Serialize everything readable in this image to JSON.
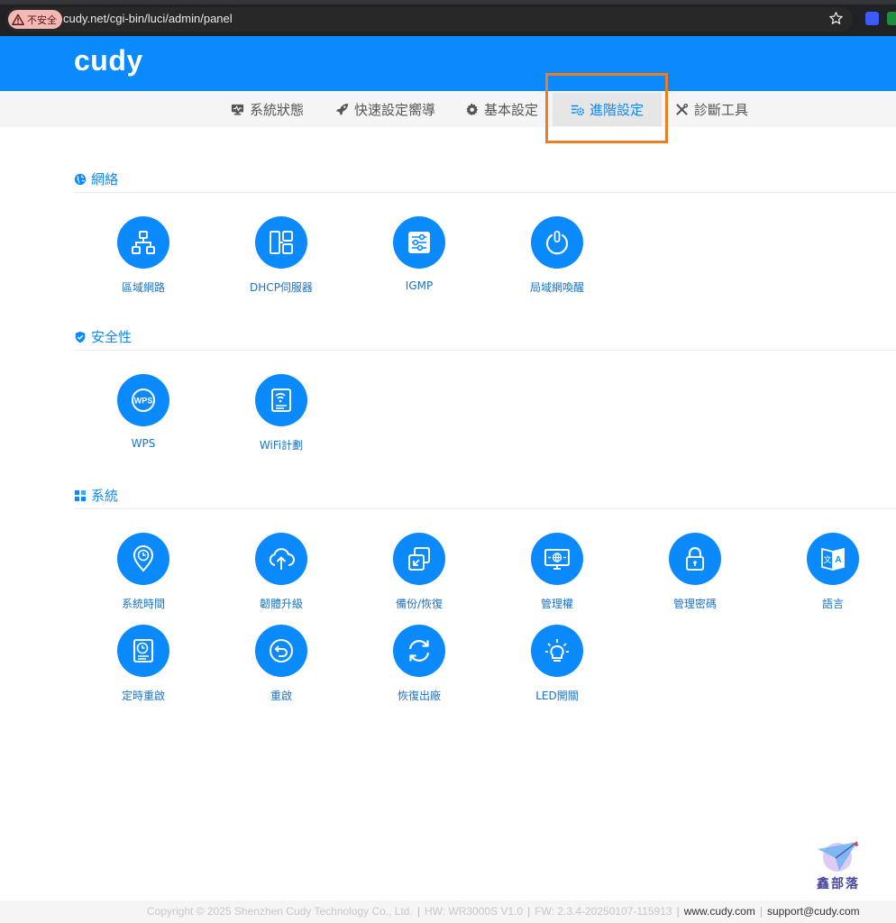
{
  "browser": {
    "security_label": "不安全",
    "url": "cudy.net/cgi-bin/luci/admin/panel"
  },
  "header": {
    "logo": "cudy"
  },
  "nav": {
    "items": [
      {
        "label": "系統狀態",
        "icon": "monitor-icon"
      },
      {
        "label": "快速設定嚮導",
        "icon": "rocket-icon"
      },
      {
        "label": "基本設定",
        "icon": "gear-icon"
      },
      {
        "label": "進階設定",
        "icon": "sliders-gear-icon",
        "active": true
      },
      {
        "label": "診斷工具",
        "icon": "tools-icon"
      }
    ]
  },
  "sections": [
    {
      "title": "網絡",
      "icon": "globe-icon",
      "items": [
        {
          "label": "區域網路",
          "icon": "lan-icon"
        },
        {
          "label": "DHCP伺服器",
          "icon": "server-icon"
        },
        {
          "label": "IGMP",
          "icon": "igmp-icon"
        },
        {
          "label": "局域網喚醒",
          "icon": "power-icon"
        }
      ]
    },
    {
      "title": "安全性",
      "icon": "shield-icon",
      "items": [
        {
          "label": "WPS",
          "icon": "wps-icon"
        },
        {
          "label": "WiFi計劃",
          "icon": "wifi-schedule-icon"
        }
      ]
    },
    {
      "title": "系統",
      "icon": "grid-icon",
      "items": [
        {
          "label": "系統時間",
          "icon": "clock-pin-icon"
        },
        {
          "label": "韌體升級",
          "icon": "cloud-upload-icon"
        },
        {
          "label": "備份/恢復",
          "icon": "backup-icon"
        },
        {
          "label": "管理權",
          "icon": "management-icon"
        },
        {
          "label": "管理密碼",
          "icon": "lock-icon"
        },
        {
          "label": "語言",
          "icon": "language-icon"
        },
        {
          "label": "定時重啟",
          "icon": "schedule-reboot-icon"
        },
        {
          "label": "重啟",
          "icon": "reboot-icon"
        },
        {
          "label": "恢復出廠",
          "icon": "factory-reset-icon"
        },
        {
          "label": "LED開關",
          "icon": "led-icon"
        }
      ]
    }
  ],
  "footer": {
    "copyright": "Copyright © 2025 Shenzhen Cudy Technology Co., Ltd.",
    "hw": "HW: WR3000S V1.0",
    "fw": "FW: 2.3.4-20250107-115913",
    "website": "www.cudy.com",
    "support": "support@cudy.com"
  },
  "watermark": {
    "text": "鑫部落"
  },
  "colors": {
    "brand": "#0a8afd",
    "highlight": "#ee7e22"
  }
}
